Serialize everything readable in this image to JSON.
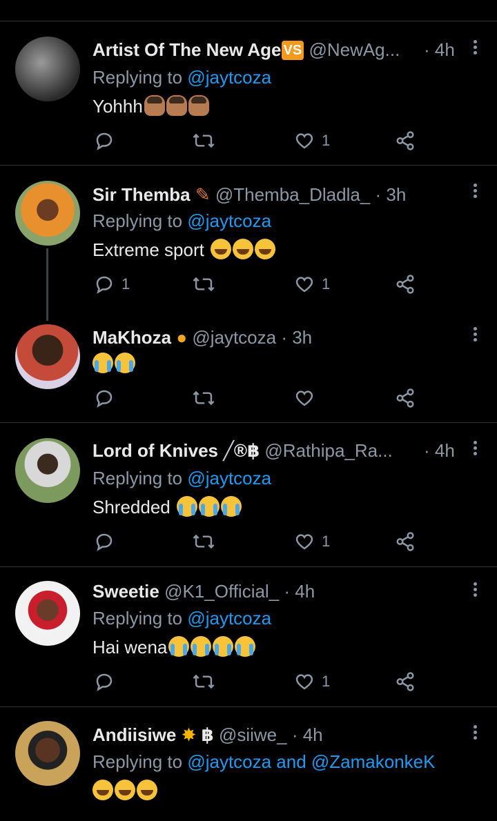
{
  "tweets": [
    {
      "name": "Artist Of The New Age",
      "badge": "VS",
      "handle": "@NewAg...",
      "time": "· 4h",
      "reply_prefix": "Replying to ",
      "reply_mentions": "@jaytcoza",
      "text": "Yohhh",
      "likes": "1",
      "replies": ""
    },
    {
      "name": "Sir Themba",
      "handle": "@Themba_Dladla_",
      "time": "· 3h",
      "reply_prefix": "Replying to ",
      "reply_mentions": "@jaytcoza",
      "text": "Extreme sport",
      "likes": "1",
      "replies": "1"
    },
    {
      "name": "MaKhoza",
      "handle": "@jaytcoza",
      "time": "· 3h",
      "text": "",
      "likes": "",
      "replies": ""
    },
    {
      "name": "Lord of Knives",
      "name_symbols": "®฿",
      "handle": "@Rathipa_Ra...",
      "time": "· 4h",
      "reply_prefix": "Replying to ",
      "reply_mentions": "@jaytcoza",
      "text": "Shredded",
      "likes": "1",
      "replies": ""
    },
    {
      "name": "Sweetie",
      "handle": "@K1_Official_",
      "time": "· 4h",
      "reply_prefix": "Replying to ",
      "reply_mentions": "@jaytcoza",
      "text": "Hai wena",
      "likes": "1",
      "replies": ""
    },
    {
      "name": "Andiisiwe",
      "name_symbols": "฿",
      "handle": "@siiwe_",
      "time": "· 4h",
      "reply_prefix": "Replying to ",
      "reply_mentions": "@jaytcoza and @ZamakonkeK",
      "text": "",
      "likes": "",
      "replies": ""
    }
  ],
  "colors": {
    "background": "#000000",
    "text": "#e7e9ea",
    "muted": "#8b98a5",
    "link": "#1d9bf0",
    "divider": "#2f3336"
  },
  "icons": [
    "reply-icon",
    "retweet-icon",
    "like-icon",
    "share-icon",
    "more-icon"
  ]
}
